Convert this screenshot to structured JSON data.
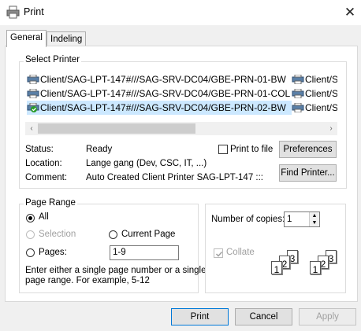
{
  "window": {
    "title": "Print",
    "close_icon": "close-icon"
  },
  "tabs": [
    {
      "label": "General"
    },
    {
      "label": "Indeling"
    }
  ],
  "select_printer": {
    "label": "Select Printer",
    "printers": [
      {
        "name": "Client/SAG-LPT-147#///SAG-SRV-DC04/GBE-PRN-01-BW"
      },
      {
        "name": "Client/SAG-LPT-147#///SAG-SRV-DC04/GBE-PRN-01-COL"
      },
      {
        "name": "Client/SAG-LPT-147#///SAG-SRV-DC04/GBE-PRN-02-BW",
        "selected": true,
        "default": true
      }
    ],
    "second_column": [
      {
        "name": "Client/S"
      },
      {
        "name": "Client/S"
      },
      {
        "name": "Client/S"
      }
    ],
    "status_label": "Status:",
    "status_value": "Ready",
    "location_label": "Location:",
    "location_value": "Lange gang (Dev, CSC, IT, ...)",
    "comment_label": "Comment:",
    "comment_value": "Auto Created Client Printer SAG-LPT-147 :::",
    "print_to_file_label": "Print to file",
    "preferences_label": "Preferences",
    "find_printer_label": "Find Printer..."
  },
  "page_range": {
    "label": "Page Range",
    "all_label": "All",
    "selection_label": "Selection",
    "current_page_label": "Current Page",
    "pages_label": "Pages:",
    "pages_value": "1-9",
    "help_text_line1": "Enter either a single page number or a single",
    "help_text_line2": "page range.  For example, 5-12"
  },
  "copies": {
    "label": "Number of copies:",
    "value": "1",
    "collate_label": "Collate",
    "page_numbers": [
      "1",
      "2",
      "3",
      "1",
      "2",
      "3"
    ]
  },
  "footer": {
    "print_label": "Print",
    "cancel_label": "Cancel",
    "apply_label": "Apply"
  }
}
